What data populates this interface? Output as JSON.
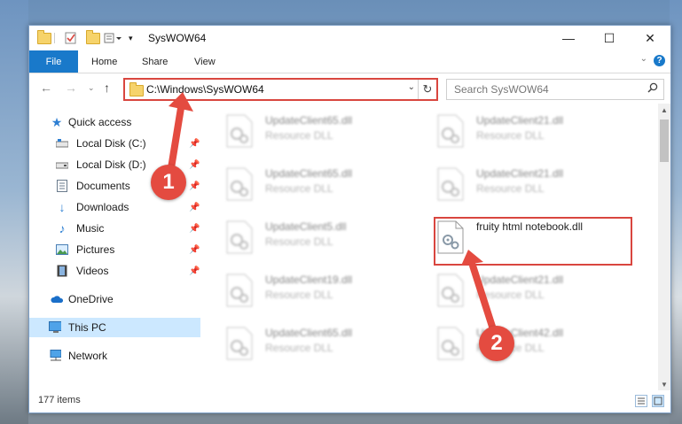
{
  "window": {
    "title": "SysWOW64",
    "controls": {
      "minimize": "—",
      "maximize": "☐",
      "close": "✕"
    }
  },
  "ribbon": {
    "tabs": [
      "File",
      "Home",
      "Share",
      "View"
    ],
    "help": "?"
  },
  "address_bar": {
    "path": "C:\\Windows\\SysWOW64",
    "search_placeholder": "Search SysWOW64"
  },
  "nav_pane": {
    "items": [
      {
        "label": "Quick access",
        "icon": "star-icon",
        "pinned": false
      },
      {
        "label": "Local Disk (C:)",
        "icon": "drive-icon",
        "pinned": true
      },
      {
        "label": "Local Disk (D:)",
        "icon": "drive-icon",
        "pinned": true
      },
      {
        "label": "Documents",
        "icon": "documents-icon",
        "pinned": true
      },
      {
        "label": "Downloads",
        "icon": "download-icon",
        "pinned": true
      },
      {
        "label": "Music",
        "icon": "music-icon",
        "pinned": true
      },
      {
        "label": "Pictures",
        "icon": "pictures-icon",
        "pinned": true
      },
      {
        "label": "Videos",
        "icon": "videos-icon",
        "pinned": true
      },
      {
        "label": "OneDrive",
        "icon": "cloud-icon",
        "pinned": false
      },
      {
        "label": "This PC",
        "icon": "computer-icon",
        "pinned": false,
        "selected": true
      },
      {
        "label": "Network",
        "icon": "network-icon",
        "pinned": false
      }
    ]
  },
  "files": [
    {
      "name": "UpdateClient65.dll",
      "type": "Resource DLL",
      "blurred": true
    },
    {
      "name": "UpdateClient21.dll",
      "type": "Resource DLL",
      "blurred": true
    },
    {
      "name": "UpdateClient65.dll",
      "type": "Resource DLL",
      "blurred": true
    },
    {
      "name": "UpdateClient21.dll",
      "type": "Resource DLL",
      "blurred": true
    },
    {
      "name": "UpdateClient5.dll",
      "type": "Resource DLL",
      "blurred": true
    },
    {
      "name": "fruity html notebook.dll",
      "type": "",
      "blurred": false,
      "highlighted": true
    },
    {
      "name": "UpdateClient19.dll",
      "type": "Resource DLL",
      "blurred": true
    },
    {
      "name": "UpdateClient21.dll",
      "type": "Resource DLL",
      "blurred": true
    },
    {
      "name": "UpdateClient65.dll",
      "type": "Resource DLL",
      "blurred": true
    },
    {
      "name": "UpdateClient42.dll",
      "type": "Resource DLL",
      "blurred": true
    }
  ],
  "status_bar": {
    "item_count": "177 items"
  },
  "annotations": {
    "step1": "1",
    "step2": "2",
    "color": "#e44b40"
  }
}
